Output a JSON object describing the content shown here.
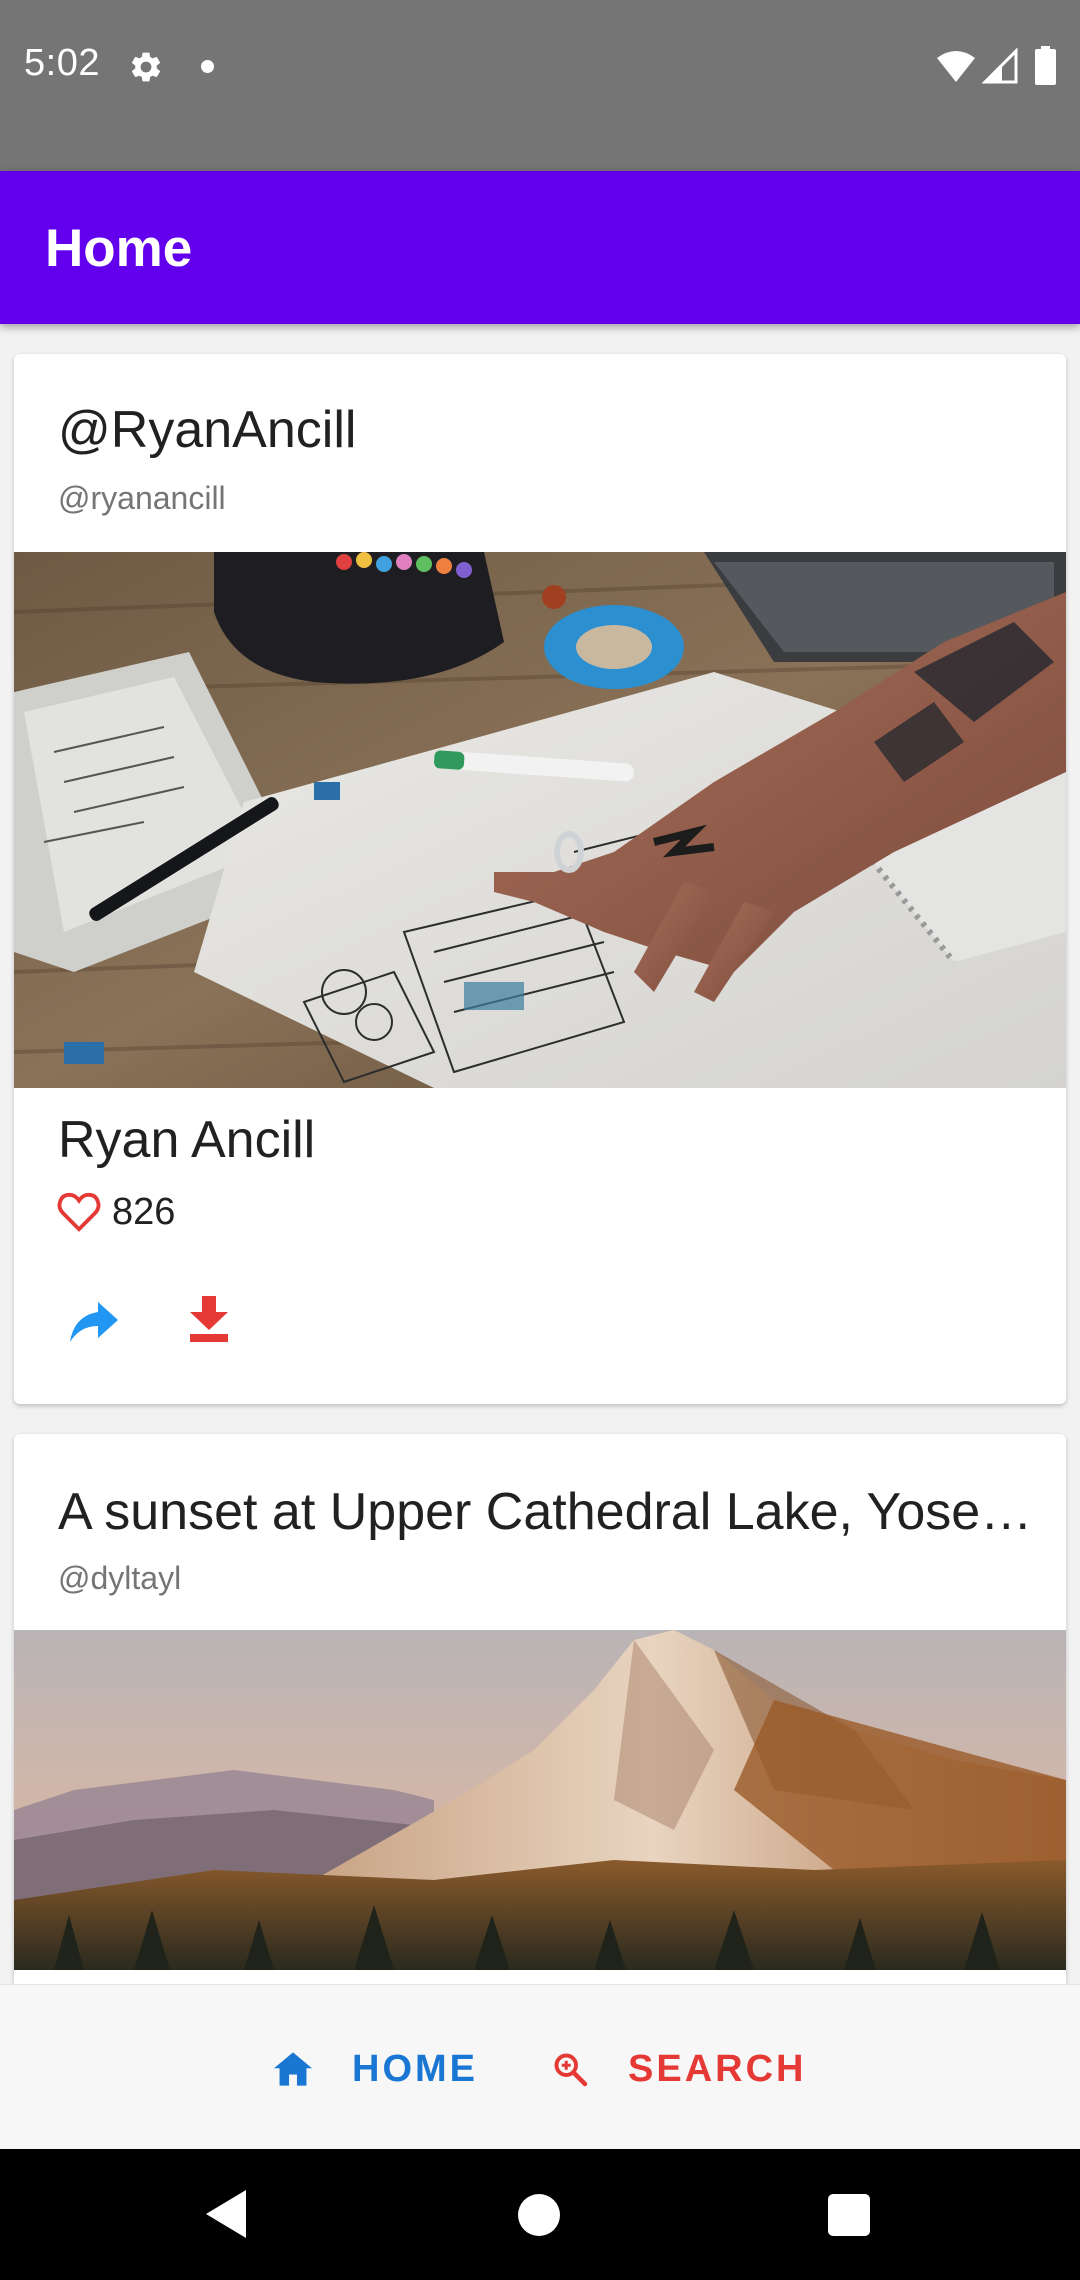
{
  "status_bar": {
    "time": "5:02",
    "icons": [
      "settings-icon",
      "notification-dot",
      "wifi-icon",
      "signal-icon",
      "battery-icon"
    ]
  },
  "app_bar": {
    "title": "Home",
    "color": "#6200ee"
  },
  "feed": {
    "cards": [
      {
        "title": "@RyanAncill",
        "subtitle": "@ryanancill",
        "photo": "architect-sketch-desk-photo",
        "author_name": "Ryan Ancill",
        "likes": "826",
        "actions": [
          "share-icon",
          "download-icon"
        ]
      },
      {
        "title": "A sunset at Upper Cathedral Lake, Yosemite",
        "subtitle": "@dyltayl",
        "photo": "mountain-sunset-photo"
      }
    ]
  },
  "bottom_nav": {
    "home_label": "HOME",
    "search_label": "SEARCH",
    "home_color": "#1976d2",
    "search_color": "#e53935"
  },
  "system_nav": {
    "buttons": [
      "back",
      "home",
      "recents"
    ]
  }
}
